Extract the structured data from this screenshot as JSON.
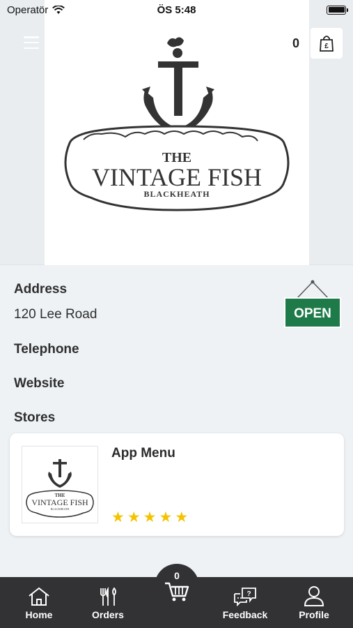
{
  "status_bar": {
    "carrier": "Operatör",
    "time": "ÖS 5:48"
  },
  "header": {
    "cart_count": "0"
  },
  "logo": {
    "line1": "THE",
    "line2": "VINTAGE FISH",
    "line3": "BLACKHEATH"
  },
  "info": {
    "address_label": "Address",
    "address_value": "120 Lee Road",
    "telephone_label": "Telephone",
    "website_label": "Website",
    "stores_label": "Stores",
    "open_sign": "OPEN",
    "open_sign_color": "#1f7a4a"
  },
  "stores": [
    {
      "name": "App Menu",
      "rating": 5
    }
  ],
  "tabbar": {
    "cart_count": "0",
    "home": "Home",
    "orders": "Orders",
    "feedback": "Feedback",
    "profile": "Profile"
  }
}
